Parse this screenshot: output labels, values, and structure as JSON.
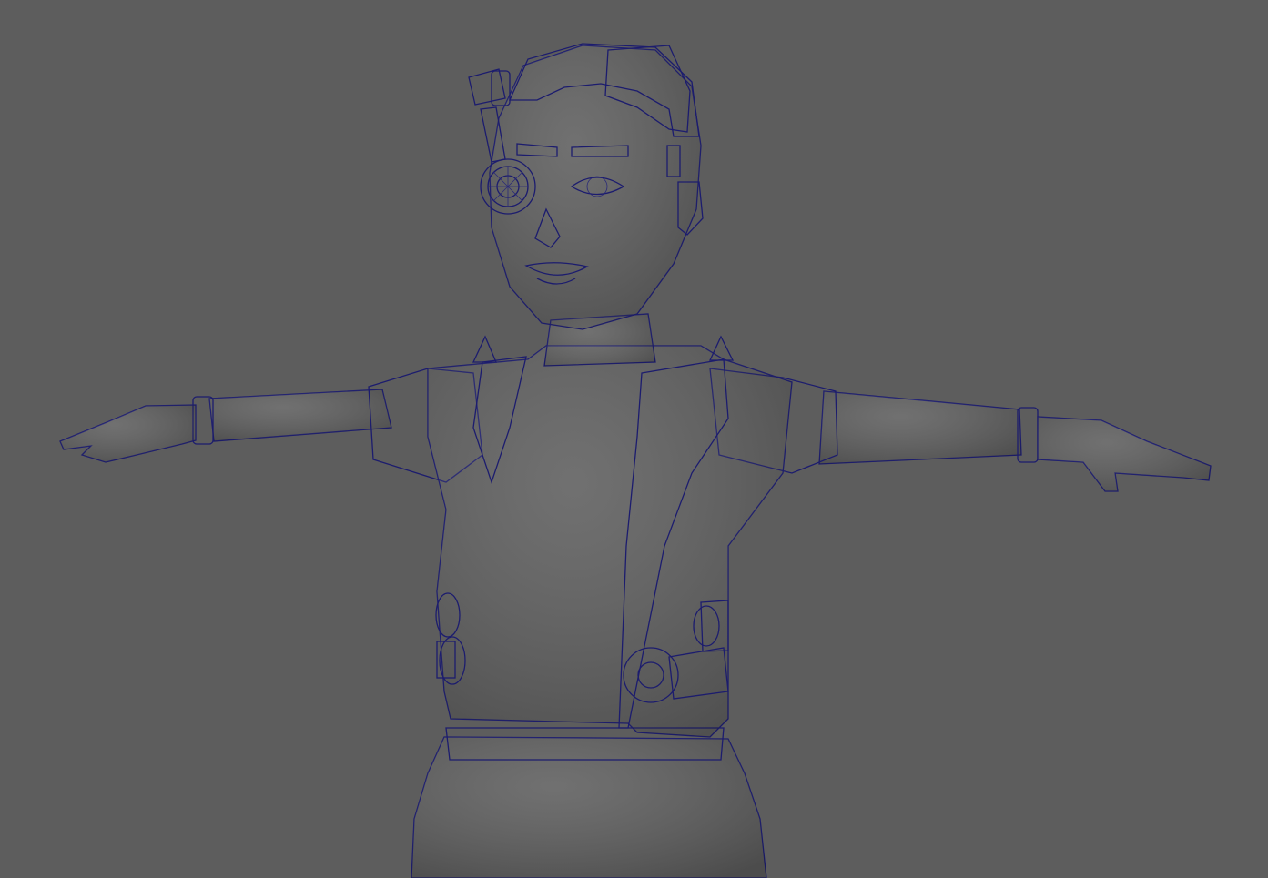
{
  "viewport": {
    "background_color": "#5d5d5d",
    "mesh_color": "#a9a9ad",
    "wireframe_color": "#23237a",
    "display_mode": "wireframe-on-shaded"
  },
  "model": {
    "pose": "T-pose",
    "parts": [
      "head",
      "hair-cap",
      "monocle-eyepiece",
      "headband-antenna",
      "ears",
      "neck",
      "vest",
      "shoulder-spikes",
      "arms",
      "wrist-bands",
      "hands",
      "belt-buckles",
      "pants"
    ]
  }
}
